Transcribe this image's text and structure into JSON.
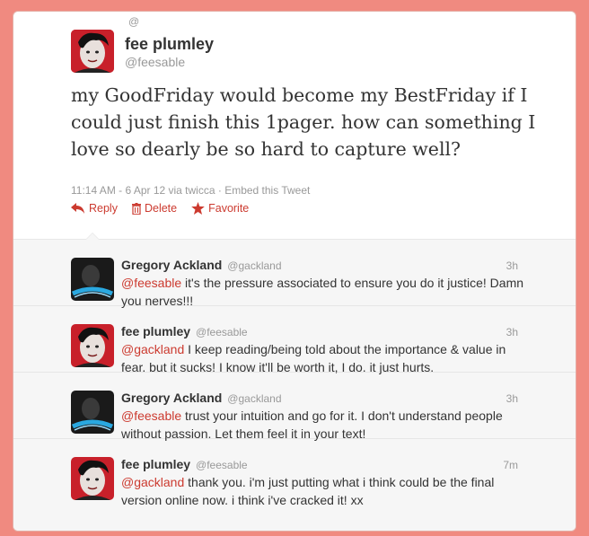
{
  "main_tweet": {
    "at_sign": "@",
    "name": "fee plumley",
    "handle": "@feesable",
    "text": "my GoodFriday would become my BestFriday if I could just finish this 1pager. how can something I love so dearly be so hard to capture well?",
    "meta": "11:14 AM - 6 Apr 12 via twicca · Embed this Tweet",
    "actions": {
      "reply": "Reply",
      "delete": "Delete",
      "favorite": "Favorite"
    }
  },
  "replies": [
    {
      "name": "Gregory Ackland",
      "handle": "@gackland",
      "time": "3h",
      "mention": "@feesable",
      "text": " it's the pressure associated to ensure you do it justice! Damn you nerves!!!",
      "avatar": "dark-avatar"
    },
    {
      "name": "fee plumley",
      "handle": "@feesable",
      "time": "3h",
      "mention": "@gackland",
      "text": " I keep reading/being told about the importance & value in fear. but it sucks! I know it'll be worth it, I do. it just hurts.",
      "avatar": "red-avatar"
    },
    {
      "name": "Gregory Ackland",
      "handle": "@gackland",
      "time": "3h",
      "mention": "@feesable",
      "text": " trust your intuition and go for it. I don't understand people without passion. Let them feel it in your text!",
      "avatar": "dark-avatar"
    },
    {
      "name": "fee plumley",
      "handle": "@feesable",
      "time": "7m",
      "mention": "@gackland",
      "text": " thank you. i'm just putting what i think could be the final version online now. i think i've cracked it! xx",
      "avatar": "red-avatar"
    }
  ],
  "colors": {
    "page_background": "#f08a80",
    "accent": "#cc3a2f",
    "muted": "#999999"
  }
}
